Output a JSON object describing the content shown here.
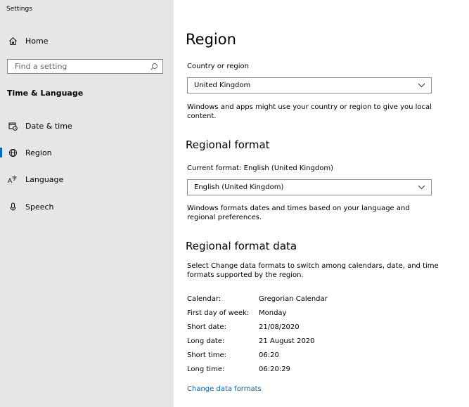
{
  "app": {
    "title": "Settings"
  },
  "sidebar": {
    "home_label": "Home",
    "search_placeholder": "Find a setting",
    "section_title": "Time & Language",
    "items": [
      {
        "label": "Date & time",
        "icon": "calendar-clock-icon"
      },
      {
        "label": "Region",
        "icon": "globe-icon",
        "selected": true
      },
      {
        "label": "Language",
        "icon": "language-icon"
      },
      {
        "label": "Speech",
        "icon": "microphone-icon"
      }
    ]
  },
  "main": {
    "title": "Region",
    "country": {
      "label": "Country or region",
      "value": "United Kingdom",
      "description": "Windows and apps might use your country or region to give you local content."
    },
    "regional_format": {
      "heading": "Regional format",
      "current_label": "Current format: English (United Kingdom)",
      "value": "English (United Kingdom)",
      "description": "Windows formats dates and times based on your language and regional preferences."
    },
    "format_data": {
      "heading": "Regional format data",
      "description": "Select Change data formats to switch among calendars, date, and time formats supported by the region.",
      "rows": [
        {
          "key": "Calendar:",
          "value": "Gregorian Calendar"
        },
        {
          "key": "First day of week:",
          "value": "Monday"
        },
        {
          "key": "Short date:",
          "value": "21/08/2020"
        },
        {
          "key": "Long date:",
          "value": "21 August 2020"
        },
        {
          "key": "Short time:",
          "value": "06:20"
        },
        {
          "key": "Long time:",
          "value": "06:20:29"
        }
      ],
      "link": "Change data formats"
    }
  },
  "colors": {
    "accent": "#0067c0",
    "sidebar_bg": "#e6e6e6"
  }
}
